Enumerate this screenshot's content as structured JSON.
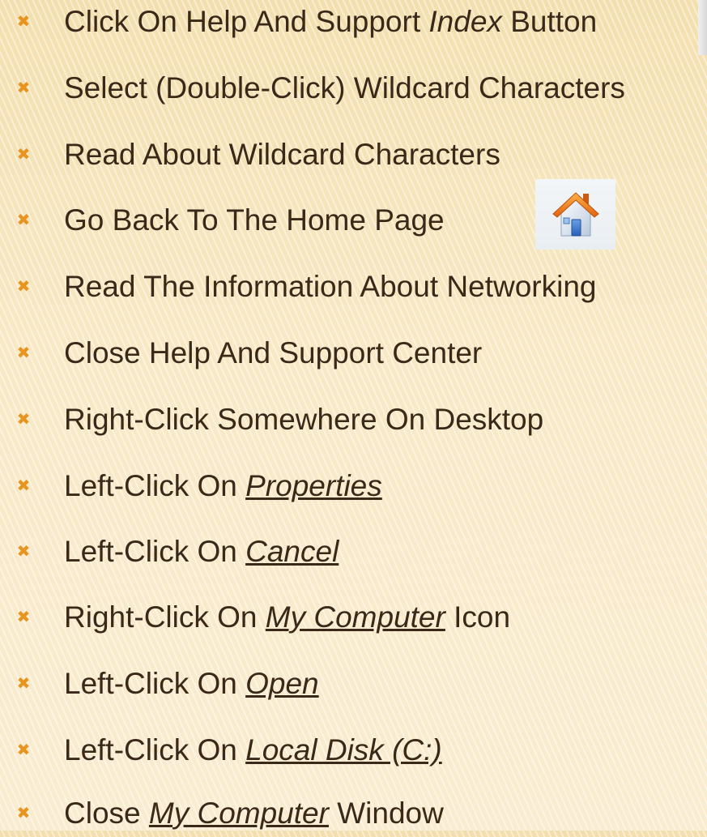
{
  "steps": [
    {
      "parts": [
        {
          "text": "Click On Help And Support ",
          "style": "plain"
        },
        {
          "text": "Index",
          "style": "italic"
        },
        {
          "text": " Button",
          "style": "plain"
        }
      ]
    },
    {
      "parts": [
        {
          "text": "Select (Double-Click) Wildcard Characters",
          "style": "plain"
        }
      ]
    },
    {
      "parts": [
        {
          "text": "Read About Wildcard Characters",
          "style": "plain"
        }
      ]
    },
    {
      "parts": [
        {
          "text": "Go Back To The Home Page",
          "style": "plain"
        }
      ]
    },
    {
      "parts": [
        {
          "text": "Read The Information About Networking",
          "style": "plain"
        }
      ]
    },
    {
      "parts": [
        {
          "text": "Close Help And Support Center",
          "style": "plain"
        }
      ]
    },
    {
      "parts": [
        {
          "text": "Right-Click Somewhere On Desktop",
          "style": "plain"
        }
      ]
    },
    {
      "parts": [
        {
          "text": "Left-Click On ",
          "style": "plain"
        },
        {
          "text": "Properties",
          "style": "underline-italic"
        }
      ]
    },
    {
      "parts": [
        {
          "text": "Left-Click On ",
          "style": "plain"
        },
        {
          "text": "Cancel",
          "style": "underline-italic"
        }
      ]
    },
    {
      "parts": [
        {
          "text": "Right-Click On ",
          "style": "plain"
        },
        {
          "text": "My Computer",
          "style": "underline-italic"
        },
        {
          "text": " Icon",
          "style": "plain"
        }
      ]
    },
    {
      "parts": [
        {
          "text": "Left-Click On ",
          "style": "plain"
        },
        {
          "text": "Open",
          "style": "underline-italic"
        }
      ]
    },
    {
      "parts": [
        {
          "text": "Left-Click On ",
          "style": "plain"
        },
        {
          "text": "Local Disk (C:)",
          "style": "underline-italic"
        }
      ]
    },
    {
      "parts": [
        {
          "text": "Close ",
          "style": "plain"
        },
        {
          "text": "My Computer",
          "style": "underline-italic"
        },
        {
          "text": " Window",
          "style": "plain"
        }
      ]
    }
  ],
  "bullet_icon": "close-x-icon",
  "images": {
    "home_button_icon": "home-icon",
    "index_button_icon": "index-button-fragment"
  },
  "colors": {
    "bullet": "#e8941f",
    "text": "#3a2818",
    "background": "#f7e6bd"
  }
}
